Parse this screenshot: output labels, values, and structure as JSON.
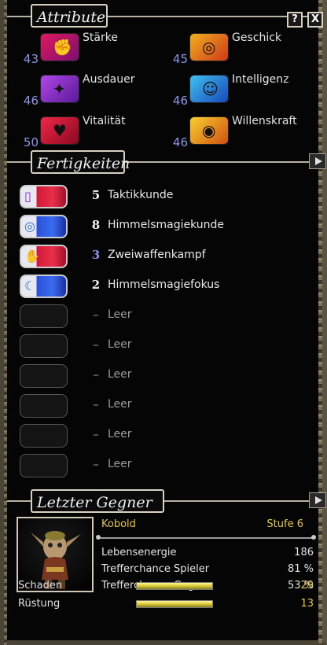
{
  "window": {
    "help_label": "?",
    "close_label": "X"
  },
  "attributes": {
    "title": "Attribute",
    "items": [
      {
        "label": "Stärke",
        "value": "43",
        "icon": "strength-icon",
        "colors": [
          "#e01860",
          "#7a1070"
        ]
      },
      {
        "label": "Geschick",
        "value": "45",
        "icon": "dexterity-icon",
        "colors": [
          "#f0b020",
          "#d03818"
        ]
      },
      {
        "label": "Ausdauer",
        "value": "46",
        "icon": "stamina-icon",
        "colors": [
          "#b048e8",
          "#5a1898"
        ]
      },
      {
        "label": "Intelligenz",
        "value": "46",
        "icon": "intelligence-icon",
        "colors": [
          "#40c0f0",
          "#1848b8"
        ]
      },
      {
        "label": "Vitalität",
        "value": "50",
        "icon": "vitality-icon",
        "colors": [
          "#f02848",
          "#8a0820"
        ]
      },
      {
        "label": "Willenskraft",
        "value": "46",
        "icon": "willpower-icon",
        "colors": [
          "#f8d030",
          "#d05010"
        ]
      }
    ]
  },
  "skills": {
    "title": "Fertigkeiten",
    "items": [
      {
        "level": "5",
        "name": "Taktikkunde",
        "color": "red",
        "icon": "tactics-icon",
        "glyph": "▯"
      },
      {
        "level": "8",
        "name": "Himmelsmagiekunde",
        "color": "blue",
        "icon": "sky-magic-icon",
        "glyph": "◎"
      },
      {
        "level": "3",
        "name": "Zweiwaffenkampf",
        "color": "red",
        "icon": "dual-wield-icon",
        "glyph": "✋"
      },
      {
        "level": "2",
        "name": "Himmelsmagiefokus",
        "color": "blue",
        "icon": "sky-focus-icon",
        "glyph": "☾"
      },
      {
        "level": "–",
        "name": "Leer",
        "color": "empty"
      },
      {
        "level": "–",
        "name": "Leer",
        "color": "empty"
      },
      {
        "level": "–",
        "name": "Leer",
        "color": "empty"
      },
      {
        "level": "–",
        "name": "Leer",
        "color": "empty"
      },
      {
        "level": "–",
        "name": "Leer",
        "color": "empty"
      },
      {
        "level": "–",
        "name": "Leer",
        "color": "empty"
      }
    ]
  },
  "enemy": {
    "title": "Letzter Gegner 1",
    "name": "Kobold",
    "level": "Stufe 6",
    "stats": [
      {
        "label": "Lebensenergie",
        "value": "186"
      },
      {
        "label": "Trefferchance Spieler",
        "value": "81 %"
      },
      {
        "label": "Trefferchance Gegner",
        "value": "53 %"
      }
    ],
    "bars": [
      {
        "label": "Schaden",
        "value": "29",
        "fill": 1.0
      },
      {
        "label": "Rüstung",
        "value": "13",
        "fill": 1.0
      }
    ]
  }
}
